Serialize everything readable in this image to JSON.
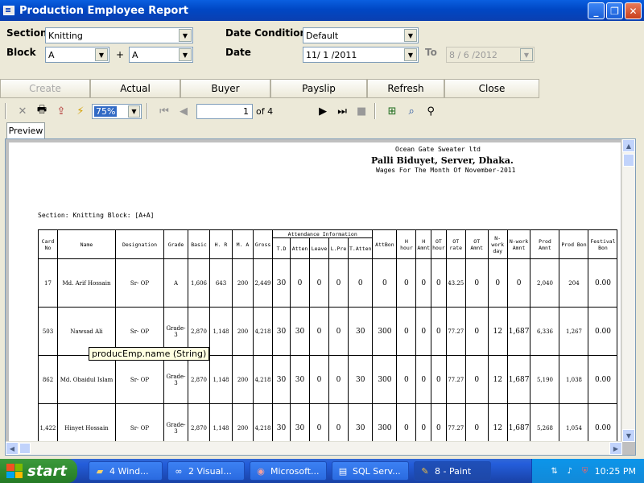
{
  "window": {
    "title": "Production Employee Report",
    "minimize": "_",
    "maximize": "❐",
    "close": "✕"
  },
  "filters": {
    "section_label": "Section",
    "section_value": "Knitting",
    "block_label": "Block",
    "block_from": "A",
    "block_plus": "+",
    "block_to": "A",
    "date_condition_label": "Date Condition",
    "date_condition_value": "Default",
    "date_label": "Date",
    "date_value": "11/ 1 /2011",
    "to_label": "To",
    "to_value": "8 / 6 /2012"
  },
  "actions": {
    "create": "Create",
    "actual": "Actual",
    "buyer": "Buyer",
    "payslip": "Payslip",
    "refresh": "Refresh",
    "close": "Close"
  },
  "toolbar": {
    "zoom": "75%",
    "page_current": "1",
    "page_of": "of 4"
  },
  "tab": {
    "preview": "Preview"
  },
  "report": {
    "company": "Ocean Gate Sweater ltd",
    "address": "Palli Biduyet, Server, Dhaka.",
    "wages": "Wages For The Month Of November-2011",
    "section_line": "Section: Knitting    Block: [A+A]",
    "att_group": "Attendance Information",
    "headers": {
      "card": "Card No",
      "name": "Name",
      "designation": "Designation",
      "grade": "Grade",
      "basic": "Basic",
      "hr": "H. R",
      "ma": "M. A",
      "gross": "Gross",
      "td": "T.D",
      "atten": "Atten",
      "leave": "Leave",
      "lpre": "L.Pre",
      "tatten": "T.Atten",
      "attbon": "AttBon",
      "hhour": "H hour",
      "hamnt": "H Amnt",
      "othour": "OT hour",
      "otrate": "OT rate",
      "otamnt": "OT Amnt",
      "nworkday": "N-work day",
      "nworkamnt": "N-work Amnt",
      "prodamnt": "Prod Amnt",
      "prodbon": "Prod Bon",
      "festbon": "Festival Bon"
    },
    "rows": [
      {
        "card": "17",
        "name": "Md. Arif Hossain",
        "designation": "Sr- OP",
        "grade": "A",
        "basic": "1,606",
        "hr": "643",
        "ma": "200",
        "gross": "2,449",
        "td": "30",
        "atten": "0",
        "leave": "0",
        "lpre": "0",
        "tatten": "0",
        "attbon": "0",
        "hhour": "0",
        "hamnt": "0",
        "othour": "0",
        "otrate": "43.25",
        "otamnt": "0",
        "nworkday": "0",
        "nworkamnt": "0",
        "prodamnt": "2,040",
        "prodbon": "204",
        "festbon": "0.00"
      },
      {
        "card": "503",
        "name": "Nawsad Ali",
        "designation": "Sr- OP",
        "grade": "Grade-3",
        "basic": "2,870",
        "hr": "1,148",
        "ma": "200",
        "gross": "4,218",
        "td": "30",
        "atten": "30",
        "leave": "0",
        "lpre": "0",
        "tatten": "30",
        "attbon": "300",
        "hhour": "0",
        "hamnt": "0",
        "othour": "0",
        "otrate": "77.27",
        "otamnt": "0",
        "nworkday": "12",
        "nworkamnt": "1,687",
        "prodamnt": "6,336",
        "prodbon": "1,267",
        "festbon": "0.00"
      },
      {
        "card": "862",
        "name": "Md. Obaidul Islam",
        "designation": "Sr- OP",
        "grade": "Grade-3",
        "basic": "2,870",
        "hr": "1,148",
        "ma": "200",
        "gross": "4,218",
        "td": "30",
        "atten": "30",
        "leave": "0",
        "lpre": "0",
        "tatten": "30",
        "attbon": "300",
        "hhour": "0",
        "hamnt": "0",
        "othour": "0",
        "otrate": "77.27",
        "otamnt": "0",
        "nworkday": "12",
        "nworkamnt": "1,687",
        "prodamnt": "5,190",
        "prodbon": "1,038",
        "festbon": "0.00"
      },
      {
        "card": "1,422",
        "name": "Hinyet Hossain",
        "designation": "Sr- OP",
        "grade": "Grade-3",
        "basic": "2,870",
        "hr": "1,148",
        "ma": "200",
        "gross": "4,218",
        "td": "30",
        "atten": "30",
        "leave": "0",
        "lpre": "0",
        "tatten": "30",
        "attbon": "300",
        "hhour": "0",
        "hamnt": "0",
        "othour": "0",
        "otrate": "77.27",
        "otamnt": "0",
        "nworkday": "12",
        "nworkamnt": "1,687",
        "prodamnt": "5,268",
        "prodbon": "1,054",
        "festbon": "0.00"
      }
    ]
  },
  "tooltip": "producEmp.name (String)",
  "taskbar": {
    "start": "start",
    "tasks": [
      {
        "label": "4 Wind...",
        "icon": "folder-icon"
      },
      {
        "label": "2 Visual...",
        "icon": "visual-studio-icon"
      },
      {
        "label": "Microsoft...",
        "icon": "browser-icon"
      },
      {
        "label": "SQL Serv...",
        "icon": "sql-server-icon"
      },
      {
        "label": "8 - Paint",
        "icon": "paint-icon"
      }
    ],
    "clock": "10:25 PM"
  }
}
